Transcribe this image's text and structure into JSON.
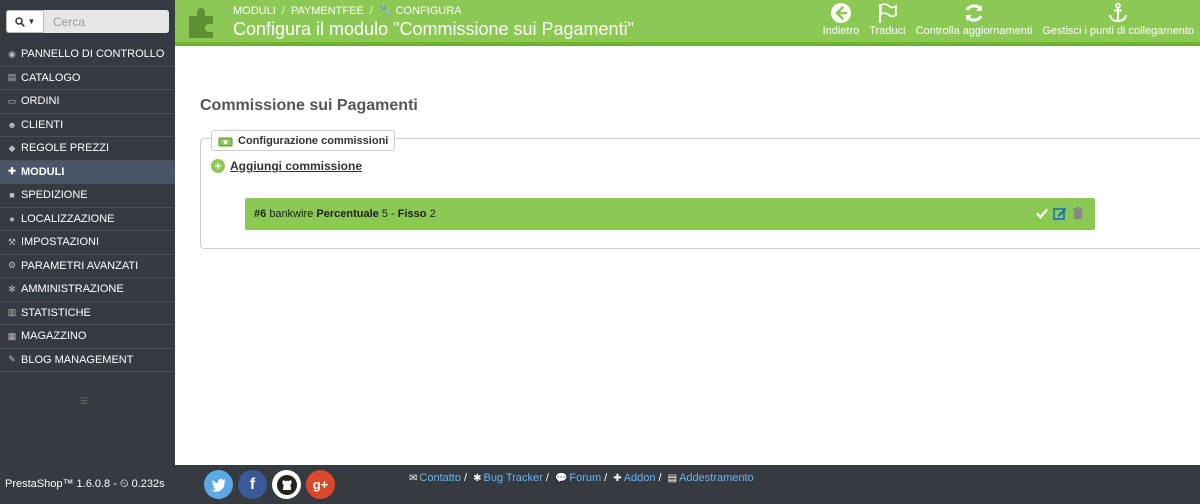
{
  "search": {
    "placeholder": "Cerca",
    "button_icon": "search-icon"
  },
  "sidebar": {
    "items": [
      {
        "label": "PANNELLO DI CONTROLLO",
        "icon": "dashboard-icon"
      },
      {
        "label": "CATALOGO",
        "icon": "book-icon"
      },
      {
        "label": "ORDINI",
        "icon": "credit-card-icon"
      },
      {
        "label": "CLIENTI",
        "icon": "users-icon"
      },
      {
        "label": "REGOLE PREZZI",
        "icon": "tags-icon"
      },
      {
        "label": "MODULI",
        "icon": "puzzle-icon",
        "active": true
      },
      {
        "label": "SPEDIZIONE",
        "icon": "truck-icon"
      },
      {
        "label": "LOCALIZZAZIONE",
        "icon": "globe-icon"
      },
      {
        "label": "IMPOSTAZIONI",
        "icon": "wrench-icon"
      },
      {
        "label": "PARAMETRI AVANZATI",
        "icon": "cogs-icon"
      },
      {
        "label": "AMMINISTRAZIONE",
        "icon": "gear-icon"
      },
      {
        "label": "STATISTICHE",
        "icon": "bar-chart-icon"
      },
      {
        "label": "MAGAZZINO",
        "icon": "archive-icon"
      },
      {
        "label": "BLOG MANAGEMENT",
        "icon": "pencil-icon"
      }
    ]
  },
  "header": {
    "breadcrumb": [
      "MODULI",
      "PAYMENTFEE",
      "CONFIGURA"
    ],
    "title": "Configura il modulo \"Commissione sui Pagamenti\"",
    "toolbar": [
      {
        "label": "Indietro",
        "icon": "arrow-left-circle-icon"
      },
      {
        "label": "Traduci",
        "icon": "flag-icon"
      },
      {
        "label": "Controlla aggiornamenti",
        "icon": "refresh-icon"
      },
      {
        "label": "Gestisci i punti di collegamento",
        "icon": "anchor-icon"
      }
    ]
  },
  "main": {
    "title": "Commissione sui Pagamenti",
    "legend": "Configurazione commissioni",
    "add_label": "Aggiungi commissione",
    "fee_row": {
      "id": "#6",
      "module": "bankwire",
      "percent_label": "Percentuale",
      "percent_value": "5",
      "dash": "-",
      "fixed_label": "Fisso",
      "fixed_value": "2"
    }
  },
  "footer": {
    "version": "PrestaShop™ 1.6.0.8 - ",
    "load_time": "0.232s",
    "links": [
      "Contatto",
      "Bug Tracker",
      "Forum",
      "Addon",
      "Addestramento"
    ],
    "social": [
      "twitter-icon",
      "facebook-icon",
      "github-icon",
      "google-plus-icon"
    ],
    "colors": {
      "accent": "#8bc954",
      "sidebar": "#363a41",
      "link": "#64b5f6"
    }
  }
}
